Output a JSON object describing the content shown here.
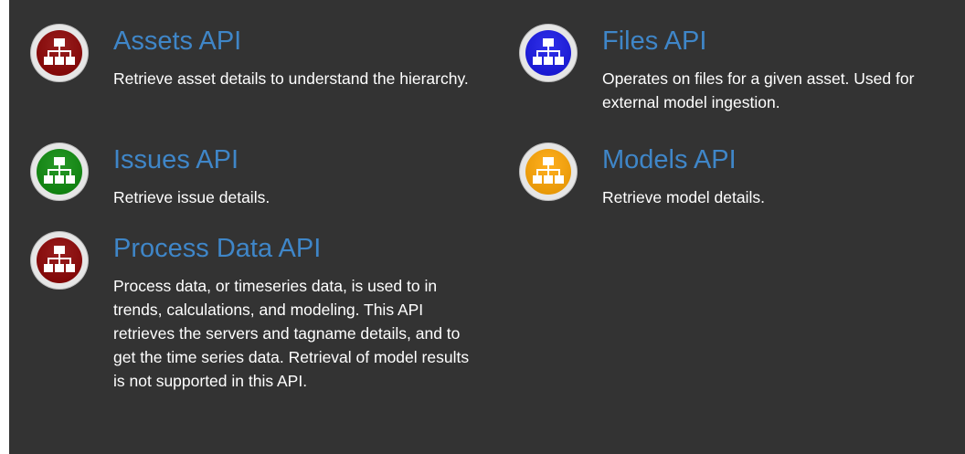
{
  "apis": {
    "assets": {
      "title": "Assets API",
      "description": "Retrieve asset details to understand the hierarchy.",
      "icon": "hierarchy-icon",
      "color": "#8b0000"
    },
    "files": {
      "title": "Files API",
      "description": "Operates on files for a given asset. Used for external model ingestion.",
      "icon": "hierarchy-icon",
      "color": "#1414e6"
    },
    "issues": {
      "title": "Issues API",
      "description": "Retrieve issue details.",
      "icon": "hierarchy-icon",
      "color": "#0a8a0a"
    },
    "models": {
      "title": "Models API",
      "description": "Retrieve model details.",
      "icon": "hierarchy-icon",
      "color": "#ffa500"
    },
    "process_data": {
      "title": "Process Data API",
      "description": "Process data, or timeseries data, is used to in trends, calculations, and modeling. This API retrieves the servers and tagname details, and to get the time series data. Retrieval of model results is not supported in this API.",
      "icon": "hierarchy-icon",
      "color": "#8b0000"
    }
  }
}
